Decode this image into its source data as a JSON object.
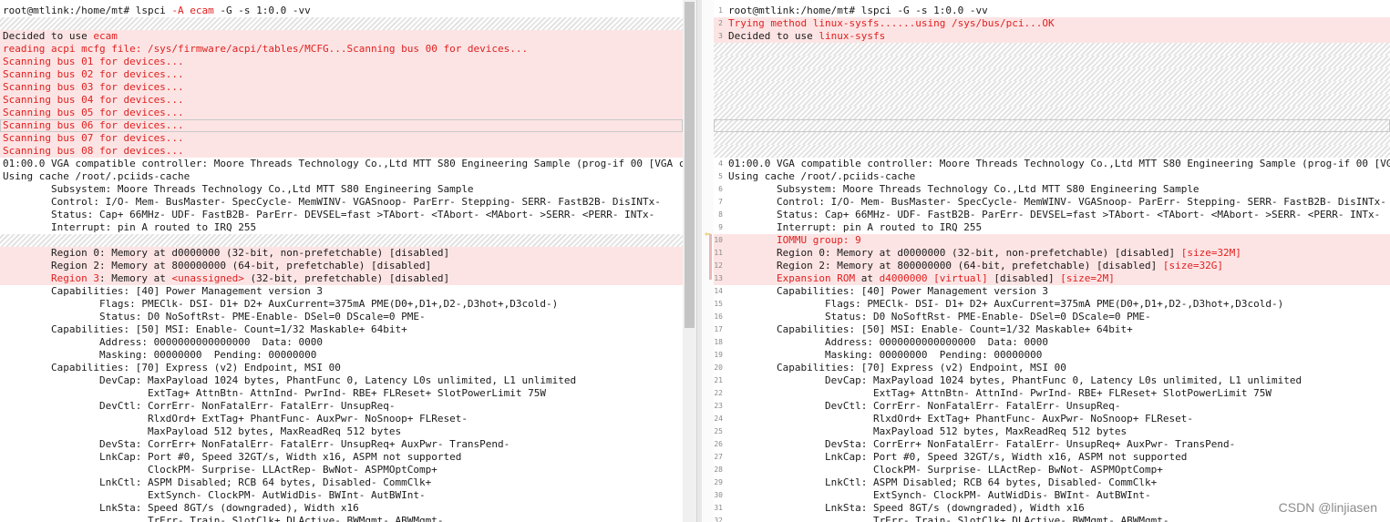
{
  "left": [
    {
      "t": "root@mtlink:/home/mt# lspci ",
      "s": [
        {
          "t": "-A ecam",
          "c": "red"
        },
        {
          "t": " -G -s 1:0.0 -vv"
        }
      ]
    },
    {
      "hatch": true
    },
    {
      "t": "Decided to use ",
      "s": [
        {
          "t": "ecam",
          "c": "red"
        }
      ],
      "bg": "diff"
    },
    {
      "t": "reading acpi mcfg file: /sys/firmware/acpi/tables/MCFG...Scanning bus 00 for devices...",
      "red": true,
      "bg": "diff"
    },
    {
      "t": "Scanning bus 01 for devices...",
      "red": true,
      "bg": "diff"
    },
    {
      "t": "Scanning bus 02 for devices...",
      "red": true,
      "bg": "diff"
    },
    {
      "t": "Scanning bus 03 for devices...",
      "red": true,
      "bg": "diff"
    },
    {
      "t": "Scanning bus 04 for devices...",
      "red": true,
      "bg": "diff"
    },
    {
      "t": "Scanning bus 05 for devices...",
      "red": true,
      "bg": "diff"
    },
    {
      "t": "Scanning bus 06 for devices...",
      "red": true,
      "bg": "diff",
      "box": true
    },
    {
      "t": "Scanning bus 07 for devices...",
      "red": true,
      "bg": "diff"
    },
    {
      "t": "Scanning bus 08 for devices...",
      "red": true,
      "bg": "diff"
    },
    {
      "t": "01:00.0 VGA compatible controller: Moore Threads Technology Co.,Ltd MTT S80 Engineering Sample (prog-if 00 [VGA controller])"
    },
    {
      "t": "Using cache /root/.pciids-cache"
    },
    {
      "t": "        Subsystem: Moore Threads Technology Co.,Ltd MTT S80 Engineering Sample"
    },
    {
      "t": "        Control: I/O- Mem- BusMaster- SpecCycle- MemWINV- VGASnoop- ParErr- Stepping- SERR- FastB2B- DisINTx-"
    },
    {
      "t": "        Status: Cap+ 66MHz- UDF- FastB2B- ParErr- DEVSEL=fast >TAbort- <TAbort- <MAbort- >SERR- <PERR- INTx-"
    },
    {
      "t": "        Interrupt: pin A routed to IRQ 255"
    },
    {
      "hatch": true
    },
    {
      "t": "        Region 0: Memory at d0000000 (32-bit, non-prefetchable) [disabled]",
      "bg": "changed"
    },
    {
      "t": "        Region 2: Memory at 800000000 (64-bit, prefetchable) [disabled]",
      "bg": "changed"
    },
    {
      "t": "        ",
      "s": [
        {
          "t": "Region 3",
          "c": "red"
        },
        {
          "t": ": Memory at "
        },
        {
          "t": "<unassigned>",
          "c": "red"
        },
        {
          "t": " (32-bit, prefetchable) [disabled]"
        }
      ],
      "bg": "changed"
    },
    {
      "t": "        Capabilities: [40] Power Management version 3"
    },
    {
      "t": "                Flags: PMEClk- DSI- D1+ D2+ AuxCurrent=375mA PME(D0+,D1+,D2-,D3hot+,D3cold-)"
    },
    {
      "t": "                Status: D0 NoSoftRst- PME-Enable- DSel=0 DScale=0 PME-"
    },
    {
      "t": "        Capabilities: [50] MSI: Enable- Count=1/32 Maskable+ 64bit+"
    },
    {
      "t": "                Address: 0000000000000000  Data: 0000"
    },
    {
      "t": "                Masking: 00000000  Pending: 00000000"
    },
    {
      "t": "        Capabilities: [70] Express (v2) Endpoint, MSI 00"
    },
    {
      "t": "                DevCap: MaxPayload 1024 bytes, PhantFunc 0, Latency L0s unlimited, L1 unlimited"
    },
    {
      "t": "                        ExtTag+ AttnBtn- AttnInd- PwrInd- RBE+ FLReset+ SlotPowerLimit 75W"
    },
    {
      "t": "                DevCtl: CorrErr- NonFatalErr- FatalErr- UnsupReq-"
    },
    {
      "t": "                        RlxdOrd+ ExtTag+ PhantFunc- AuxPwr- NoSnoop+ FLReset-"
    },
    {
      "t": "                        MaxPayload 512 bytes, MaxReadReq 512 bytes"
    },
    {
      "t": "                DevSta: CorrErr+ NonFatalErr- FatalErr- UnsupReq+ AuxPwr- TransPend-"
    },
    {
      "t": "                LnkCap: Port #0, Speed 32GT/s, Width x16, ASPM not supported"
    },
    {
      "t": "                        ClockPM- Surprise- LLActRep- BwNot- ASPMOptComp+"
    },
    {
      "t": "                LnkCtl: ASPM Disabled; RCB 64 bytes, Disabled- CommClk+"
    },
    {
      "t": "                        ExtSynch- ClockPM- AutWidDis- BWInt- AutBWInt-"
    },
    {
      "t": "                LnkSta: Speed 8GT/s (downgraded), Width x16"
    },
    {
      "t": "                        TrErr- Train- SlotClk+ DLActive- BWMgmt- ABWMgmt-"
    }
  ],
  "right": [
    {
      "n": "1",
      "t": "root@mtlink:/home/mt# lspci -G -s 1:0.0 -vv"
    },
    {
      "n": "2",
      "t": "Trying method linux-sysfs......using /sys/bus/pci...OK",
      "red": true,
      "bg": "diff"
    },
    {
      "n": "3",
      "t": "Decided to use ",
      "s": [
        {
          "t": "linux-sysfs",
          "c": "red"
        }
      ],
      "bg": "diff"
    },
    {
      "hatch": true
    },
    {
      "hatch": true
    },
    {
      "hatch": true
    },
    {
      "hatch": true
    },
    {
      "hatch": true
    },
    {
      "hatch": true
    },
    {
      "hatch": true,
      "box": true
    },
    {
      "hatch": true
    },
    {
      "hatch": true
    },
    {
      "n": "4",
      "t": "01:00.0 VGA compatible controller: Moore Threads Technology Co.,Ltd MTT S80 Engineering Sample (prog-if 00 [VGA controller])"
    },
    {
      "n": "5",
      "t": "Using cache /root/.pciids-cache"
    },
    {
      "n": "6",
      "t": "        Subsystem: Moore Threads Technology Co.,Ltd MTT S80 Engineering Sample"
    },
    {
      "n": "7",
      "t": "        Control: I/O- Mem- BusMaster- SpecCycle- MemWINV- VGASnoop- ParErr- Stepping- SERR- FastB2B- DisINTx-"
    },
    {
      "n": "8",
      "t": "        Status: Cap+ 66MHz- UDF- FastB2B- ParErr- DEVSEL=fast >TAbort- <TAbort- <MAbort- >SERR- <PERR- INTx-"
    },
    {
      "n": "9",
      "t": "        Interrupt: pin A routed to IRQ 255"
    },
    {
      "n": "10",
      "t": "        ",
      "s": [
        {
          "t": "IOMMU group: 9",
          "c": "red"
        }
      ],
      "bg": "diff"
    },
    {
      "n": "11",
      "t": "        Region 0: Memory at d0000000 (32-bit, non-prefetchable) [disabled] ",
      "s": [
        {
          "t": "[size=32M]",
          "c": "red"
        }
      ],
      "bg": "changed"
    },
    {
      "n": "12",
      "t": "        Region 2: Memory at 800000000 (64-bit, prefetchable) [disabled] ",
      "s": [
        {
          "t": "[size=32G]",
          "c": "red"
        }
      ],
      "bg": "changed"
    },
    {
      "n": "13",
      "t": "        ",
      "s": [
        {
          "t": "Expansion ROM",
          "c": "red"
        },
        {
          "t": " at "
        },
        {
          "t": "d4000000 [virtual]",
          "c": "red"
        },
        {
          "t": " [disabled] "
        },
        {
          "t": "[size=2M]",
          "c": "red"
        }
      ],
      "bg": "changed"
    },
    {
      "n": "14",
      "t": "        Capabilities: [40] Power Management version 3"
    },
    {
      "n": "15",
      "t": "                Flags: PMEClk- DSI- D1+ D2+ AuxCurrent=375mA PME(D0+,D1+,D2-,D3hot+,D3cold-)"
    },
    {
      "n": "16",
      "t": "                Status: D0 NoSoftRst- PME-Enable- DSel=0 DScale=0 PME-"
    },
    {
      "n": "17",
      "t": "        Capabilities: [50] MSI: Enable- Count=1/32 Maskable+ 64bit+"
    },
    {
      "n": "18",
      "t": "                Address: 0000000000000000  Data: 0000"
    },
    {
      "n": "19",
      "t": "                Masking: 00000000  Pending: 00000000"
    },
    {
      "n": "20",
      "t": "        Capabilities: [70] Express (v2) Endpoint, MSI 00"
    },
    {
      "n": "21",
      "t": "                DevCap: MaxPayload 1024 bytes, PhantFunc 0, Latency L0s unlimited, L1 unlimited"
    },
    {
      "n": "22",
      "t": "                        ExtTag+ AttnBtn- AttnInd- PwrInd- RBE+ FLReset+ SlotPowerLimit 75W"
    },
    {
      "n": "23",
      "t": "                DevCtl: CorrErr- NonFatalErr- FatalErr- UnsupReq-"
    },
    {
      "n": "24",
      "t": "                        RlxdOrd+ ExtTag+ PhantFunc- AuxPwr- NoSnoop+ FLReset-"
    },
    {
      "n": "25",
      "t": "                        MaxPayload 512 bytes, MaxReadReq 512 bytes"
    },
    {
      "n": "26",
      "t": "                DevSta: CorrErr+ NonFatalErr- FatalErr- UnsupReq+ AuxPwr- TransPend-"
    },
    {
      "n": "27",
      "t": "                LnkCap: Port #0, Speed 32GT/s, Width x16, ASPM not supported"
    },
    {
      "n": "28",
      "t": "                        ClockPM- Surprise- LLActRep- BwNot- ASPMOptComp+"
    },
    {
      "n": "29",
      "t": "                LnkCtl: ASPM Disabled; RCB 64 bytes, Disabled- CommClk+"
    },
    {
      "n": "30",
      "t": "                        ExtSynch- ClockPM- AutWidDis- BWInt- AutBWInt-"
    },
    {
      "n": "31",
      "t": "                LnkSta: Speed 8GT/s (downgraded), Width x16"
    },
    {
      "n": "32",
      "t": "                        TrErr- Train- SlotClk+ DLActive- BWMgmt- ABWMgmt-"
    }
  ],
  "gutter_icon": "diff-arrow-icon",
  "watermark": "CSDN @linjiasen",
  "colors": {
    "diff_bg": "#fde4e4",
    "red_text": "#e02020"
  }
}
